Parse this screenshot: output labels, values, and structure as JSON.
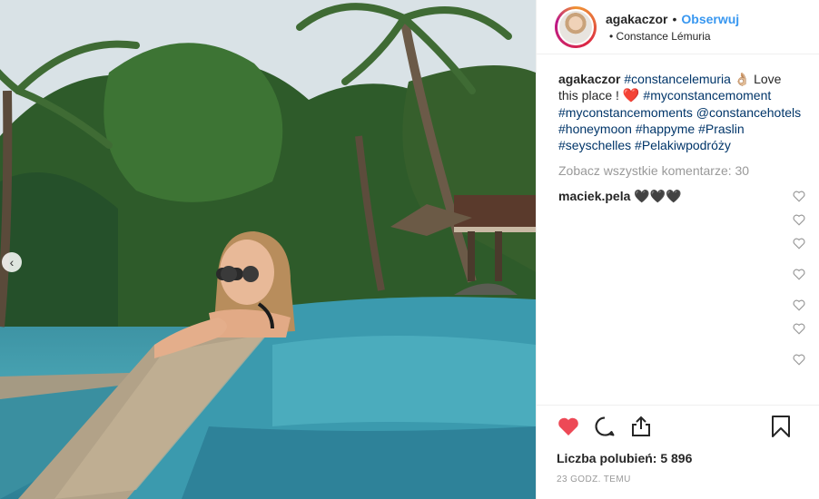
{
  "post": {
    "username": "agakaczor",
    "follow_label": "Obserwuj",
    "location": "Constance Lémuria",
    "caption_user": "agakaczor",
    "caption_tag1": "#constancelemuria",
    "caption_emoji": "👌🏼",
    "caption_text1": "Love this place !",
    "caption_heart": "❤️",
    "caption_tags2": "#myconstancemoment #myconstancemoments @constancehotels #honeymoon #happyme #Praslin #seyschelles #Pelakiwpodróży",
    "view_all": "Zobacz wszystkie komentarze: 30",
    "comment_user": "maciek.pela",
    "comment_text": "🖤🖤🖤",
    "likes": "Liczba polubień: 5 896",
    "time": "23 GODZ. TEMU"
  },
  "icons": {
    "like": "heart-filled",
    "comment": "speech-bubble",
    "share": "share-upload",
    "save": "bookmark",
    "prev": "chevron-left"
  },
  "colors": {
    "like_red": "#ed4956",
    "follow_blue": "#3897f0",
    "tag_blue": "#003569"
  }
}
